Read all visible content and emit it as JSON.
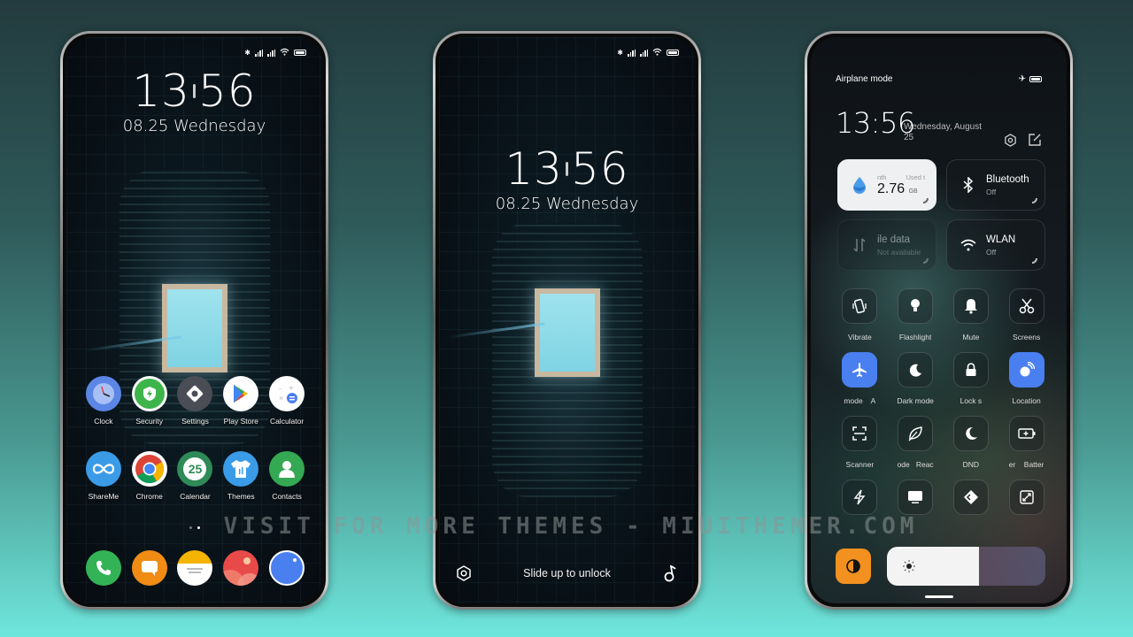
{
  "colors": {
    "accent_blue": "#4a7ff0",
    "auto_brightness_orange": "#f29120",
    "tile_light": "#eef0f2"
  },
  "status_bar": {
    "icons": [
      "bluetooth-icon",
      "signal-hd-icon",
      "signal-hd-icon",
      "wifi-icon",
      "battery-icon"
    ]
  },
  "home_screen": {
    "time_hour": "13",
    "time_minute": "56",
    "date": "08.25 Wednesday",
    "apps_row1": [
      {
        "label": "Clock",
        "icon": "clock-icon",
        "color": "#5b86e5"
      },
      {
        "label": "Security",
        "icon": "shield-bolt-icon",
        "color": "#3db54a"
      },
      {
        "label": "Settings",
        "icon": "settings-icon",
        "color": "#4a4d55"
      },
      {
        "label": "Play Store",
        "icon": "play-store-icon",
        "color": "#ffffff"
      },
      {
        "label": "Calculator",
        "icon": "calculator-icon",
        "color": "#ffffff"
      }
    ],
    "apps_row2": [
      {
        "label": "ShareMe",
        "icon": "infinity-icon",
        "color": "#3a9be8"
      },
      {
        "label": "Chrome",
        "icon": "chrome-icon",
        "color": "#ffffff"
      },
      {
        "label": "Calendar",
        "icon": "calendar-icon",
        "color": "#2e8b57",
        "text": "25"
      },
      {
        "label": "Themes",
        "icon": "themes-shirt-icon",
        "color": "#3a9be8"
      },
      {
        "label": "Contacts",
        "icon": "contact-icon",
        "color": "#34a853"
      }
    ],
    "page_indicator": {
      "pages": 2,
      "current": 2
    },
    "dock": [
      {
        "name": "phone",
        "icon": "phone-icon",
        "color": "#34b356"
      },
      {
        "name": "messages",
        "icon": "message-icon",
        "color": "#f08c14"
      },
      {
        "name": "notes",
        "icon": "notes-icon",
        "color": "#ffffff"
      },
      {
        "name": "gallery",
        "icon": "gallery-icon",
        "color": "#e84a4a"
      },
      {
        "name": "browser",
        "icon": "browser-icon",
        "color": "#4a7ff0"
      }
    ]
  },
  "lock_screen": {
    "time_hour": "13",
    "time_minute": "56",
    "date": "08.25 Wednesday",
    "unlock_hint": "Slide up to unlock",
    "left_shortcut_icon": "hexagon-settings-icon",
    "right_shortcut_icon": "music-note-icon"
  },
  "control_center": {
    "mode_label": "Airplane mode",
    "time": "13:56",
    "date": "Wednesday, August 25",
    "date_line1": "Wednesday, August",
    "date_line2": "25",
    "tiles": {
      "data_usage": {
        "head_left": "nth",
        "head_right": "Used t",
        "value": "2.76",
        "unit": "GB"
      },
      "bluetooth": {
        "title": "Bluetooth",
        "status": "Off"
      },
      "mobile_data": {
        "title": "ile data",
        "status": "Not available"
      },
      "wlan": {
        "title": "WLAN",
        "status": "Off"
      }
    },
    "toggles_row1": [
      {
        "label": "Vibrate",
        "icon": "vibrate-icon",
        "on": false
      },
      {
        "label": "Flashlight",
        "icon": "flashlight-icon",
        "on": false
      },
      {
        "label": "Mute",
        "icon": "bell-icon",
        "on": false
      },
      {
        "label": "Screens",
        "icon": "scissors-icon",
        "on": false
      }
    ],
    "toggles_row2": [
      {
        "label": "mode    A",
        "icon": "airplane-icon",
        "on": true
      },
      {
        "label": "Dark mode",
        "icon": "dark-mode-icon",
        "on": false
      },
      {
        "label": "Lock s",
        "icon": "lock-icon",
        "on": false
      },
      {
        "label": "Location",
        "icon": "location-icon",
        "on": true
      }
    ],
    "toggles_row3": [
      {
        "label": "Scanner",
        "icon": "scanner-icon",
        "on": false
      },
      {
        "label": "ode   Reac",
        "icon": "leaf-icon",
        "on": false
      },
      {
        "label": "DND",
        "icon": "moon-icon",
        "on": false
      },
      {
        "label": "er    Batter",
        "icon": "battery-saver-icon",
        "on": false
      }
    ],
    "toggles_row4": [
      {
        "label": "",
        "icon": "bolt-icon",
        "on": false
      },
      {
        "label": "",
        "icon": "cast-icon",
        "on": false
      },
      {
        "label": "",
        "icon": "quick-ball-icon",
        "on": false
      },
      {
        "label": "",
        "icon": "floating-window-icon",
        "on": false
      }
    ],
    "brightness_percent": 58
  },
  "watermark": "VISIT FOR MORE THEMES - MIUITHEMER.COM"
}
